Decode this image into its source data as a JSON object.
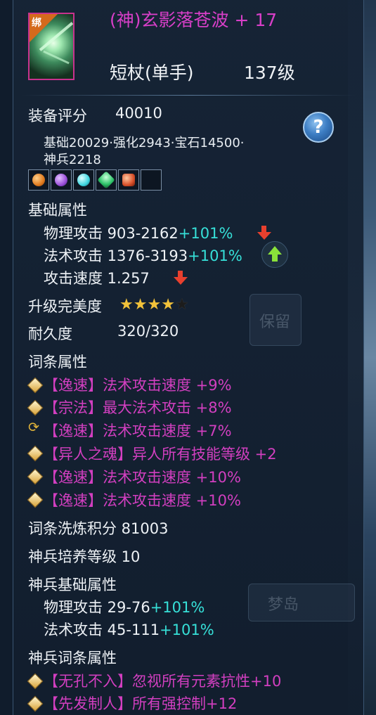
{
  "item": {
    "bind_badge": "绑",
    "name": "(神)玄影落苍波 + 17",
    "type": "短杖(单手)",
    "level": "137级"
  },
  "score": {
    "label": "装备评分",
    "value": "40010"
  },
  "score_breakdown": {
    "line1": "基础20029·强化2943·宝石14500·",
    "line2": "神兵2218"
  },
  "help_symbol": "?",
  "gems": [
    {
      "icon": "orange-gem-icon",
      "color": "#e07a1e"
    },
    {
      "icon": "purple-gem-icon",
      "color": "#9b4fd8"
    },
    {
      "icon": "cyan-gem-icon",
      "color": "#3fd6e0"
    },
    {
      "icon": "green-gem-icon",
      "color": "#2fc46a"
    },
    {
      "icon": "red-orange-gem-icon",
      "color": "#d8502a"
    },
    {
      "icon": "empty-slot",
      "color": ""
    }
  ],
  "base": {
    "title": "基础属性",
    "phys": {
      "label": "物理攻击 903-2162",
      "bonus": "+101%"
    },
    "magic": {
      "label": "法术攻击 1376-3193",
      "bonus": "+101%"
    },
    "speed": {
      "label": "攻击速度 1.257"
    }
  },
  "upgrade": {
    "label": "升级完美度",
    "stars_filled": 4,
    "stars_total": 5,
    "star_char": "★"
  },
  "durability": {
    "label": "耐久度",
    "value": "320/320"
  },
  "affix": {
    "title": "词条属性",
    "lines": [
      "【逸速】法术攻击速度 +9%",
      "【宗法】最大法术攻击 +8%",
      "【逸速】法术攻击速度 +7%",
      "【异人之魂】异人所有技能等级 +2",
      "【逸速】法术攻击速度 +10%",
      "【逸速】法术攻击速度 +10%"
    ]
  },
  "refine_score": "词条洗炼积分 81003",
  "shenbing_level": "神兵培养等级 10",
  "shenbing_base": {
    "title": "神兵基础属性",
    "phys": {
      "label": "物理攻击 29-76",
      "bonus": "+101%"
    },
    "magic": {
      "label": "法术攻击 45-111",
      "bonus": "+101%"
    }
  },
  "shenbing_affix": {
    "title": "神兵词条属性",
    "lines": [
      "【无孔不入】忽视所有元素抗性+10",
      "【先发制人】所有强控制+12"
    ]
  },
  "background": {
    "keep_label": "保留",
    "dream_island": "梦岛"
  },
  "colors": {
    "name": "#d83fc8",
    "bonus": "#36e0d8",
    "affix": "#d23fc0",
    "arrow_down": "#e8402e",
    "arrow_up": "#8ae23a"
  }
}
